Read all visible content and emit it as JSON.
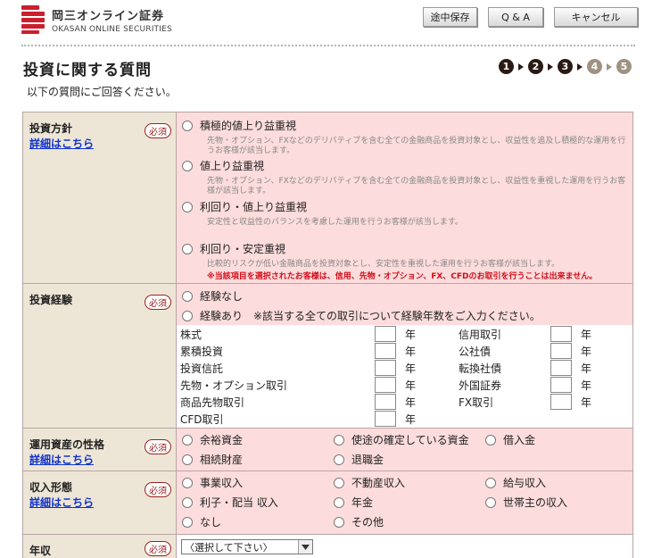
{
  "header": {
    "logo_name": "岡三オンライン証券",
    "logo_sub": "OKASAN ONLINE SECURITIES",
    "buttons": [
      "途中保存",
      "Q & A",
      "キャンセル"
    ]
  },
  "page": {
    "title": "投資に関する質問",
    "subtitle": "以下の質問にご回答ください。",
    "steps": [
      "1",
      "2",
      "3",
      "4",
      "5"
    ],
    "current_step": 3
  },
  "required_label": "必須",
  "detail_link": "詳細はこちら",
  "policy": {
    "label": "投資方針",
    "options": [
      {
        "label": "積極的値上り益重視",
        "desc": "先物・オプション、FXなどのデリバティブを含む全ての金融商品を投資対象とし、収益性を追及し積極的な運用を行うお客様が該当します。"
      },
      {
        "label": "値上り益重視",
        "desc": "先物・オプション、FXなどのデリバティブを含む全ての金融商品を投資対象とし、収益性を重視した運用を行うお客様が該当します。"
      },
      {
        "label": "利回り・値上り益重視",
        "desc": "安定性と収益性のバランスを考慮した運用を行うお客様が該当します。"
      },
      {
        "label": "利回り・安定重視",
        "desc": "比較的リスクが低い金融商品を投資対象とし、安定性を重視した運用を行うお客様が該当します。"
      }
    ],
    "warning": "※当該項目を選択されたお客様は、信用、先物・オプション、FX、CFDのお取引を行うことは出来ません。"
  },
  "experience": {
    "label": "投資経験",
    "none": "経験なし",
    "has": "経験あり　※該当する全ての取引について経験年数をご入力ください。",
    "unit": "年",
    "left_items": [
      "株式",
      "累積投資",
      "投資信託",
      "先物・オプション取引",
      "商品先物取引",
      "CFD取引"
    ],
    "right_items": [
      "信用取引",
      "公社債",
      "転換社債",
      "外国証券",
      "FX取引"
    ]
  },
  "assets": {
    "label": "運用資産の性格",
    "options": [
      "余裕資金",
      "使途の確定している資金",
      "借入金",
      "相続財産",
      "退職金"
    ]
  },
  "income": {
    "label": "収入形態",
    "options": [
      "事業収入",
      "不動産収入",
      "給与収入",
      "利子・配当 収入",
      "年金",
      "世帯主の収入",
      "なし",
      "その他"
    ]
  },
  "annual": {
    "label": "年収",
    "select_value": "〈選択して下さい〉"
  }
}
